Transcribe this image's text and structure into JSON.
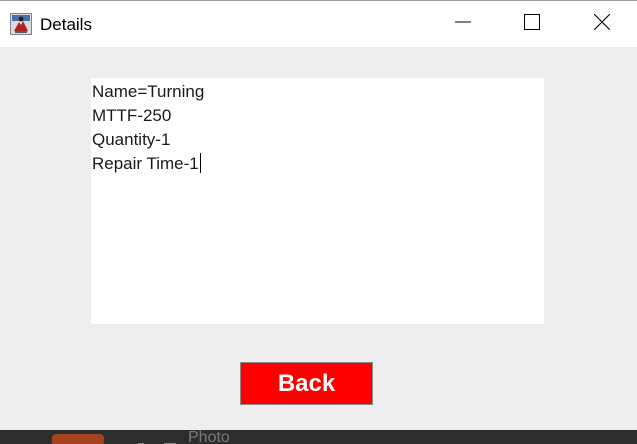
{
  "window": {
    "title": "Details",
    "icon": "java-app-icon"
  },
  "controls": {
    "minimize": "minimize-icon",
    "maximize": "maximize-icon",
    "close": "close-icon"
  },
  "details": {
    "lines": [
      "Name=Turning",
      "MTTF-250",
      "Quantity-1",
      "Repair Time-1"
    ]
  },
  "buttons": {
    "back_label": "Back"
  },
  "colors": {
    "back_button": "#ff0000",
    "window_bg": "#eeeeee",
    "titlebar_bg": "#ffffff"
  },
  "taskbar": {
    "partial_label": "Photo"
  }
}
